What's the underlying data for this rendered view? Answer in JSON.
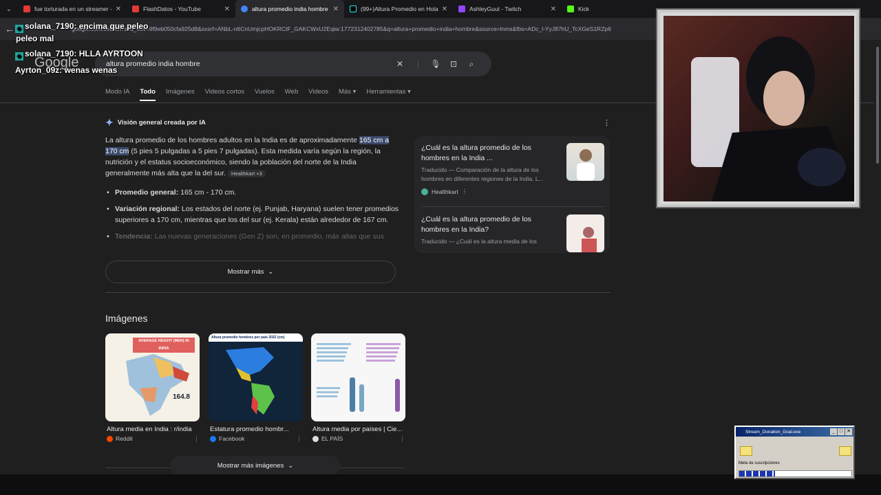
{
  "tabs": [
    {
      "title": "fue torturada en un streamer - ",
      "color": "#e53935",
      "active": false
    },
    {
      "title": "FlashDatos - YouTube",
      "color": "#e53935",
      "active": false
    },
    {
      "title": "altura promedio india hombre",
      "color": "#4285f4",
      "active": true
    },
    {
      "title": "(99+)Altura Promedio en Hola",
      "color": "#000000",
      "active": false
    },
    {
      "title": "AshleyGuut - Twitch",
      "color": "#9146ff",
      "active": false
    },
    {
      "title": "Kick",
      "color": "#53fc18",
      "active": false
    }
  ],
  "address": {
    "url": "google.com/search?sca_esv=9f9eb050cfa925d8&sxsrf=ANbL-n6CnUmjcpHOKRCtF_GAKCWxU2Eqiw:1772312402785&q=altura+promedio+india+hombre&source=lnms&fbs=ADc_l-YyJ87hU_TcXGeS1RZp6"
  },
  "google": {
    "logo": "Google",
    "query": "altura promedio india hombre",
    "nav": [
      "Modo IA",
      "Todo",
      "Imágenes",
      "Videos cortos",
      "Vuelos",
      "Web",
      "Videos",
      "Más ▾",
      "Herramientas ▾"
    ]
  },
  "ai": {
    "heading": "Visión general creada por IA",
    "p1_a": "La altura promedio de los hombres adultos en la India es de aproximadamente ",
    "p1_hl": "165 cm a 170 cm",
    "p1_b": " (5 pies 5 pulgadas a 5 pies 7 pulgadas). Esta medida varía según la región, la nutrición y el estatus socioeconómico, siendo la población del norte de la India generalmente más alta que la del sur. ",
    "cite": "Healthkart +3",
    "b1_bold": "Promedio general:",
    "b1": " 165 cm - 170 cm.",
    "b2_bold": "Variación regional:",
    "b2": " Los estados del norte (ej. Punjab, Haryana) suelen tener promedios superiores a 170 cm, mientras que los del sur (ej. Kerala) están alrededor de 167 cm.",
    "b3_bold": "Tendencia:",
    "b3": " Las nuevas generaciones (Gen Z) son, en promedio, más altas que sus",
    "more": "Mostrar más"
  },
  "side": {
    "c1_q": "¿Cuál es la altura promedio de los hombres en la India ...",
    "c1_d": "Traducido — Comparación de la altura de los hombres en diferentes regiones de la India. L...",
    "c1_src": "Healthkart",
    "c2_q": "¿Cuál es la altura promedio de los hombres en la India?",
    "c2_d": "Traducido — ¿Cuál es la altura media de los"
  },
  "images": {
    "title": "Imágenes",
    "items": [
      {
        "caption": "Altura media en India : r/india",
        "source": "Reddit",
        "inner": "AVERAGE HEIGHT (MEN) IN INDIA",
        "value": "164.8"
      },
      {
        "caption": "Estatura promedio hombr...",
        "source": "Facebook",
        "inner": "Altura promedio hombres por país 2022 (cm)"
      },
      {
        "caption": "Altura media por países | Cie...",
        "source": "EL PAÍS"
      }
    ],
    "more": "Mostrar más imágenes"
  },
  "chat": [
    {
      "user": "solana_7190",
      "msg": ": encima que peleo"
    },
    {
      "user": "",
      "msg": "peleo mal"
    },
    {
      "user": "solana_7190",
      "msg": ": HLLA AYRTOON"
    },
    {
      "user": "Ayrton_09z",
      "msg": ": wenas wenas"
    }
  ],
  "donation": {
    "title": "Stream_Donation_Goal.exe",
    "label": "Meta de suscripciones",
    "progress": 0.32
  }
}
